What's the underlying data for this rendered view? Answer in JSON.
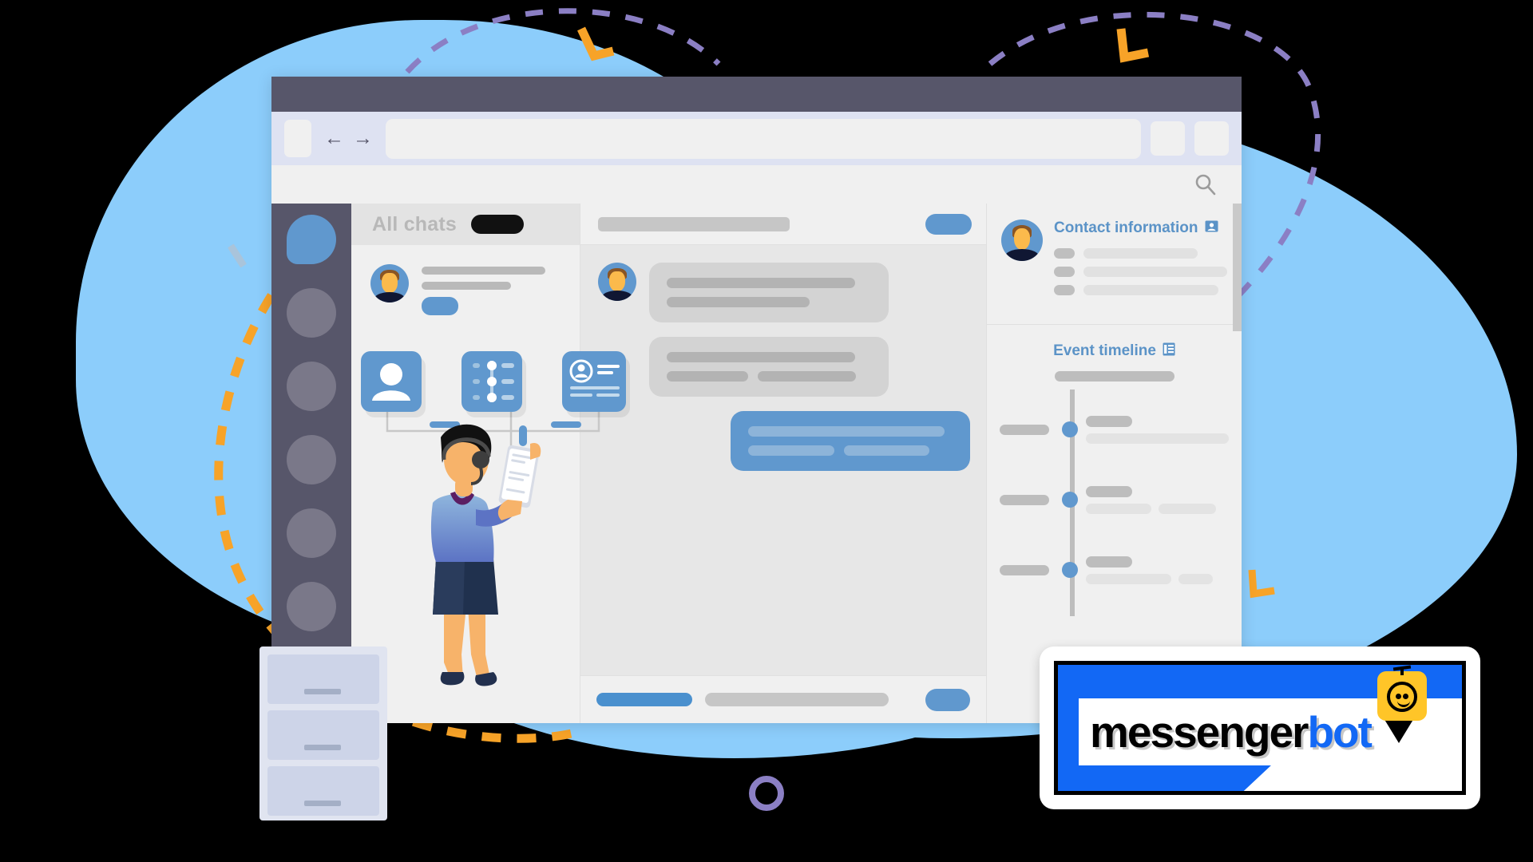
{
  "page": {
    "title": "Messenger Bot live chat dashboard illustration",
    "background_color": "#000000",
    "blob_color": "#8CCDFB"
  },
  "colors": {
    "accent_blue": "#6098CE",
    "brand_blue": "#1268F5",
    "dark_chrome": "#57566A",
    "orange": "#F7A328",
    "purple": "#8B7FC4",
    "panel_gray": "#F0F0F0",
    "bubble_gray": "#D3D3D3",
    "robot_yellow": "#FFC528"
  },
  "browser": {
    "titlebar_name": "window-titlebar",
    "nav": {
      "back_icon": "←",
      "forward_icon": "→"
    },
    "url_value": "",
    "url_placeholder": "",
    "buttons": [
      "browser-button-1",
      "browser-button-2"
    ]
  },
  "app": {
    "search_icon": "search-icon",
    "rail": {
      "items": [
        {
          "name": "rail-item-chats",
          "active": true
        },
        {
          "name": "rail-item-contacts",
          "active": false
        },
        {
          "name": "rail-item-campaigns",
          "active": false
        },
        {
          "name": "rail-item-automation",
          "active": false
        },
        {
          "name": "rail-item-reports",
          "active": false
        },
        {
          "name": "rail-item-settings",
          "active": false
        }
      ]
    },
    "chat_list": {
      "header_label": "All chats",
      "header_badge": "",
      "rows": [
        {
          "name": "chat-row-1",
          "line_widths": [
            "86%",
            "62%"
          ],
          "tag": ""
        }
      ]
    },
    "conversation": {
      "header_bar": "",
      "header_button": "",
      "messages": [
        {
          "side": "in",
          "lines": [
            "92%",
            "70%"
          ]
        },
        {
          "side": "in",
          "lines": [
            "92%",
            "split"
          ]
        },
        {
          "side": "out",
          "lines": [
            "96%",
            "split"
          ]
        }
      ],
      "composer": {
        "tab_label": "",
        "input_placeholder": "",
        "send_label": ""
      }
    },
    "contact_panel": {
      "title": "Contact information",
      "title_icon": "contact-card-icon",
      "fields": [
        {
          "key": "",
          "value_width": "66%"
        },
        {
          "key": "",
          "value_width": "94%"
        },
        {
          "key": "",
          "value_width": "78%"
        }
      ]
    },
    "event_timeline": {
      "title": "Event timeline",
      "title_icon": "timeline-list-icon",
      "events": [
        {
          "time": "",
          "heading": "",
          "bars": [
            "58%",
            "0%"
          ]
        },
        {
          "time": "",
          "heading": "",
          "bars": [
            "42%",
            "38%"
          ]
        },
        {
          "time": "",
          "heading": "",
          "bars": [
            "54%",
            "24%"
          ]
        }
      ]
    }
  },
  "illustration": {
    "feature_cards": [
      {
        "name": "feature-card-profile",
        "icon": "user-avatar-icon"
      },
      {
        "name": "feature-card-timeline",
        "icon": "timeline-steps-icon"
      },
      {
        "name": "feature-card-contact",
        "icon": "contact-details-icon"
      }
    ],
    "agent": {
      "name": "support-agent-illustration",
      "description": "woman with headset holding a smartphone"
    },
    "cabinet": {
      "name": "filing-cabinet-illustration",
      "drawers": 3
    },
    "decorations": {
      "purple_ring": "purple-ring-decoration",
      "orange_dashes": "orange-dashed-path",
      "purple_dashes": "purple-dashed-arc",
      "orange_brackets": 3,
      "blue_ticks": 2
    }
  },
  "logo": {
    "word_one": "messenger",
    "word_two": "bot",
    "robot_icon": "robot-mascot-icon"
  }
}
